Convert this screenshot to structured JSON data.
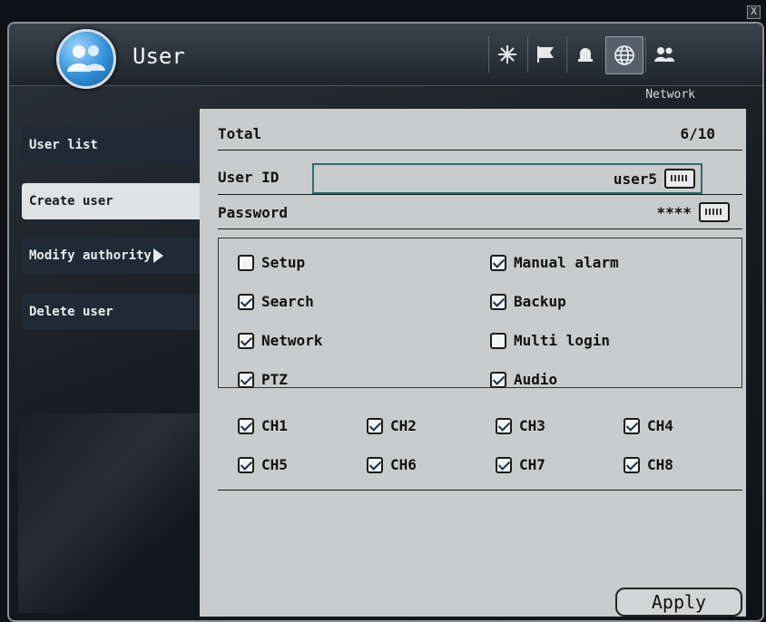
{
  "window": {
    "close_label": "X",
    "title": "User"
  },
  "toolbar": {
    "caption": "Network",
    "buttons": [
      {
        "icon": "snowflake-icon"
      },
      {
        "icon": "flag-icon"
      },
      {
        "icon": "alarm-icon"
      },
      {
        "icon": "globe-icon",
        "active": true
      },
      {
        "icon": "users-icon"
      }
    ]
  },
  "sidebar": {
    "items": [
      {
        "label": "User list"
      },
      {
        "label": "Create user"
      },
      {
        "label": "Modify authority"
      },
      {
        "label": "Delete user"
      }
    ]
  },
  "form": {
    "total_label": "Total",
    "total_value": "6/10",
    "userid_label": "User ID",
    "userid_value": "user5",
    "password_label": "Password",
    "password_value": "****"
  },
  "permissions": [
    {
      "label": "Setup",
      "checked": false
    },
    {
      "label": "Manual alarm",
      "checked": true
    },
    {
      "label": "Search",
      "checked": true
    },
    {
      "label": "Backup",
      "checked": true
    },
    {
      "label": "Network",
      "checked": true
    },
    {
      "label": "Multi login",
      "checked": false
    },
    {
      "label": "PTZ",
      "checked": true
    },
    {
      "label": "Audio",
      "checked": true
    }
  ],
  "channels": [
    {
      "label": "CH1",
      "checked": true
    },
    {
      "label": "CH2",
      "checked": true
    },
    {
      "label": "CH3",
      "checked": true
    },
    {
      "label": "CH4",
      "checked": true
    },
    {
      "label": "CH5",
      "checked": true
    },
    {
      "label": "CH6",
      "checked": true
    },
    {
      "label": "CH7",
      "checked": true
    },
    {
      "label": "CH8",
      "checked": true
    }
  ],
  "apply_label": "Apply"
}
